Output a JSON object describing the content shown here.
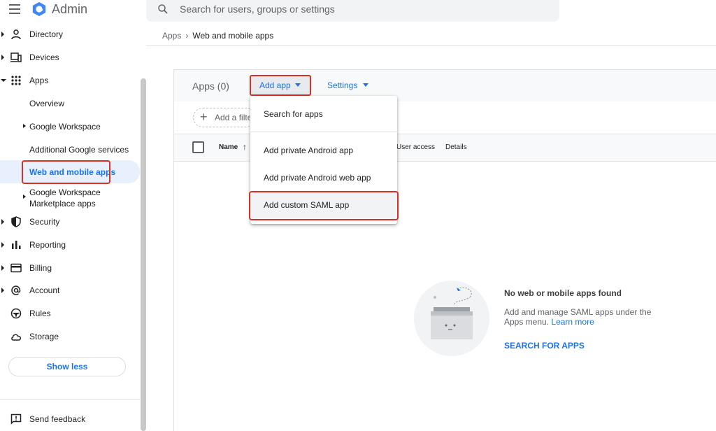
{
  "header": {
    "app_title": "Admin",
    "search_placeholder": "Search for users, groups or settings"
  },
  "breadcrumb": {
    "parent": "Apps",
    "current": "Web and mobile apps"
  },
  "sidebar": {
    "items": [
      {
        "label": "Directory",
        "icon": "person-icon"
      },
      {
        "label": "Devices",
        "icon": "devices-icon"
      },
      {
        "label": "Apps",
        "icon": "apps-grid-icon"
      },
      {
        "label": "Security",
        "icon": "shield-icon"
      },
      {
        "label": "Reporting",
        "icon": "bar-chart-icon"
      },
      {
        "label": "Billing",
        "icon": "credit-card-icon"
      },
      {
        "label": "Account",
        "icon": "at-sign-icon"
      },
      {
        "label": "Rules",
        "icon": "steering-wheel-icon"
      },
      {
        "label": "Storage",
        "icon": "cloud-icon"
      }
    ],
    "apps_sub": {
      "overview": "Overview",
      "google_workspace": "Google Workspace",
      "additional": "Additional Google services",
      "active": "Web and mobile apps",
      "marketplace_line1": "Google Workspace",
      "marketplace_line2": "Marketplace apps"
    },
    "show_less": "Show less",
    "send_feedback": "Send feedback"
  },
  "main": {
    "apps_count": "Apps (0)",
    "add_app": "Add app",
    "settings": "Settings",
    "add_filter": "Add a filter",
    "columns": {
      "name": "Name",
      "user_access": "User access",
      "details": "Details"
    }
  },
  "dropdown": {
    "search": "Search for apps",
    "android": "Add private Android app",
    "android_web": "Add private Android web app",
    "saml": "Add custom SAML app"
  },
  "empty_state": {
    "title": "No web or mobile apps found",
    "description": "Add and manage SAML apps under the Apps menu.",
    "learn_more": "Learn more",
    "search_link": "SEARCH FOR APPS"
  },
  "colors": {
    "accent": "#1a73e8",
    "highlight_box": "#d93025",
    "active_bg": "#e8f0fe"
  }
}
